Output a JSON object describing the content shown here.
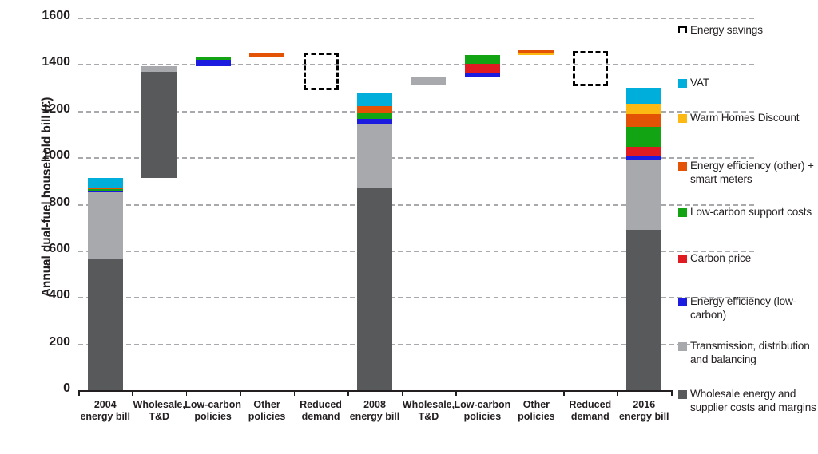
{
  "chart_data": {
    "type": "bar",
    "title": "",
    "subtitle": "",
    "xlabel": "",
    "ylabel": "Annual dual-fuel household bill (£)",
    "ylim": [
      0,
      1600
    ],
    "yticks": [
      0,
      200,
      400,
      600,
      800,
      1000,
      1200,
      1400,
      1600
    ],
    "grid": true,
    "legend_position": "right",
    "waterfall": true,
    "categories": [
      "2004 energy bill",
      "Wholesale, T&D",
      "Low-carbon policies",
      "Other policies",
      "Reduced demand",
      "2008 energy bill",
      "Wholesale, T&D",
      "Low-carbon policies",
      "Other policies",
      "Reduced demand",
      "2016 energy bill"
    ],
    "series": [
      {
        "name": "Wholesale energy and supplier costs and margins",
        "color": "#58595b",
        "values": [
          565,
          455,
          0,
          0,
          0,
          870,
          0,
          0,
          0,
          0,
          690
        ]
      },
      {
        "name": "Transmission, distribution and balancing",
        "color": "#a7a9ac",
        "values": [
          285,
          20,
          0,
          0,
          0,
          275,
          35,
          0,
          0,
          0,
          300
        ]
      },
      {
        "name": "Energy efficiency (low-carbon)",
        "color": "#1c1ce0",
        "values": [
          5,
          0,
          28,
          0,
          0,
          20,
          0,
          15,
          0,
          0,
          15
        ]
      },
      {
        "name": "Carbon price",
        "color": "#e01b22",
        "values": [
          0,
          0,
          0,
          0,
          0,
          0,
          0,
          40,
          0,
          0,
          40
        ]
      },
      {
        "name": "Low-carbon support costs",
        "color": "#13a413",
        "values": [
          8,
          0,
          10,
          0,
          0,
          25,
          0,
          38,
          0,
          0,
          85
        ]
      },
      {
        "name": "Energy efficiency (other) + smart meters",
        "color": "#e35205",
        "values": [
          7,
          0,
          0,
          22,
          0,
          28,
          0,
          0,
          10,
          0,
          55
        ]
      },
      {
        "name": "Warm Homes Discount",
        "color": "#fdb913",
        "values": [
          0,
          0,
          0,
          0,
          0,
          0,
          0,
          0,
          12,
          0,
          45
        ]
      },
      {
        "name": "VAT",
        "color": "#00aedb",
        "values": [
          43,
          0,
          0,
          0,
          0,
          57,
          0,
          0,
          0,
          0,
          70
        ]
      },
      {
        "name": "Energy savings",
        "color": "#000000",
        "style": "dashed-outline",
        "values": [
          0,
          0,
          0,
          0,
          -150,
          0,
          0,
          0,
          0,
          -150,
          0
        ]
      }
    ],
    "bar_stacks": [
      {
        "label": "2004 energy bill",
        "type": "total",
        "base": 0,
        "segments": [
          {
            "name": "Wholesale energy and supplier costs and margins",
            "color": "#58595b",
            "from": 0,
            "to": 565
          },
          {
            "name": "Transmission, distribution and balancing",
            "color": "#a7a9ac",
            "from": 565,
            "to": 850
          },
          {
            "name": "Energy efficiency (low-carbon)",
            "color": "#1c1ce0",
            "from": 850,
            "to": 855
          },
          {
            "name": "Low-carbon support costs",
            "color": "#13a413",
            "from": 855,
            "to": 863
          },
          {
            "name": "Energy efficiency (other) + smart meters",
            "color": "#e35205",
            "from": 863,
            "to": 870
          },
          {
            "name": "VAT",
            "color": "#00aedb",
            "from": 870,
            "to": 913
          }
        ]
      },
      {
        "label": "Wholesale, T&D",
        "type": "delta",
        "base": 913,
        "segments": [
          {
            "name": "Wholesale energy and supplier costs and margins",
            "color": "#58595b",
            "from": 913,
            "to": 1368
          },
          {
            "name": "Transmission, distribution and balancing",
            "color": "#a7a9ac",
            "from": 1368,
            "to": 1390
          }
        ]
      },
      {
        "label": "Low-carbon policies",
        "type": "delta",
        "base": 1390,
        "segments": [
          {
            "name": "Energy efficiency (low-carbon)",
            "color": "#1c1ce0",
            "from": 1390,
            "to": 1418
          },
          {
            "name": "Low-carbon support costs",
            "color": "#13a413",
            "from": 1418,
            "to": 1428
          }
        ]
      },
      {
        "label": "Other policies",
        "type": "delta",
        "base": 1428,
        "segments": [
          {
            "name": "Energy efficiency (other) + smart meters",
            "color": "#e35205",
            "from": 1428,
            "to": 1448
          }
        ]
      },
      {
        "label": "Reduced demand",
        "type": "savings",
        "base": 1448,
        "segments": [
          {
            "name": "Energy savings",
            "color": "#000000",
            "from": 1288,
            "to": 1448,
            "dashed": true
          }
        ]
      },
      {
        "label": "2008 energy bill",
        "type": "total",
        "base": 0,
        "segments": [
          {
            "name": "Wholesale energy and supplier costs and margins",
            "color": "#58595b",
            "from": 0,
            "to": 870
          },
          {
            "name": "Transmission, distribution and balancing",
            "color": "#a7a9ac",
            "from": 870,
            "to": 1145
          },
          {
            "name": "Energy efficiency (low-carbon)",
            "color": "#1c1ce0",
            "from": 1145,
            "to": 1165
          },
          {
            "name": "Low-carbon support costs",
            "color": "#13a413",
            "from": 1165,
            "to": 1190
          },
          {
            "name": "Energy efficiency (other) + smart meters",
            "color": "#e35205",
            "from": 1190,
            "to": 1218
          },
          {
            "name": "VAT",
            "color": "#00aedb",
            "from": 1218,
            "to": 1275
          }
        ]
      },
      {
        "label": "Wholesale, T&D",
        "type": "delta",
        "base": 1275,
        "segments": [
          {
            "name": "Transmission, distribution and balancing",
            "color": "#a7a9ac",
            "from": 1310,
            "to": 1345
          }
        ]
      },
      {
        "label": "Low-carbon policies",
        "type": "delta",
        "base": 1345,
        "segments": [
          {
            "name": "Energy efficiency (low-carbon)",
            "color": "#1c1ce0",
            "from": 1345,
            "to": 1360
          },
          {
            "name": "Carbon price",
            "color": "#e01b22",
            "from": 1360,
            "to": 1400
          },
          {
            "name": "Low-carbon support costs",
            "color": "#13a413",
            "from": 1400,
            "to": 1438
          }
        ]
      },
      {
        "label": "Other policies",
        "type": "delta",
        "base": 1438,
        "segments": [
          {
            "name": "Warm Homes Discount",
            "color": "#fdb913",
            "from": 1438,
            "to": 1450
          },
          {
            "name": "Energy efficiency (other) + smart meters",
            "color": "#e35205",
            "from": 1450,
            "to": 1460
          }
        ]
      },
      {
        "label": "Reduced demand",
        "type": "savings",
        "base": 1460,
        "segments": [
          {
            "name": "Energy savings",
            "color": "#000000",
            "from": 1305,
            "to": 1455,
            "dashed": true
          }
        ]
      },
      {
        "label": "2016 energy bill",
        "type": "total",
        "base": 0,
        "segments": [
          {
            "name": "Wholesale energy and supplier costs and margins",
            "color": "#58595b",
            "from": 0,
            "to": 690
          },
          {
            "name": "Transmission, distribution and balancing",
            "color": "#a7a9ac",
            "from": 690,
            "to": 990
          },
          {
            "name": "Energy efficiency (low-carbon)",
            "color": "#1c1ce0",
            "from": 990,
            "to": 1005
          },
          {
            "name": "Carbon price",
            "color": "#e01b22",
            "from": 1005,
            "to": 1045
          },
          {
            "name": "Low-carbon support costs",
            "color": "#13a413",
            "from": 1045,
            "to": 1130
          },
          {
            "name": "Energy efficiency (other) + smart meters",
            "color": "#e35205",
            "from": 1130,
            "to": 1185
          },
          {
            "name": "Warm Homes Discount",
            "color": "#fdb913",
            "from": 1185,
            "to": 1230
          },
          {
            "name": "VAT",
            "color": "#00aedb",
            "from": 1230,
            "to": 1300
          }
        ]
      }
    ],
    "legend": [
      {
        "label": "Energy savings",
        "color": "#000000",
        "style": "dashed-outline"
      },
      {
        "label": "VAT",
        "color": "#00aedb",
        "style": "solid"
      },
      {
        "label": "Warm Homes Discount",
        "color": "#fdb913",
        "style": "solid"
      },
      {
        "label": "Energy efficiency (other) + smart meters",
        "color": "#e35205",
        "style": "solid"
      },
      {
        "label": "Low-carbon support costs",
        "color": "#13a413",
        "style": "solid"
      },
      {
        "label": "Carbon price",
        "color": "#e01b22",
        "style": "solid"
      },
      {
        "label": "Energy efficiency (low-carbon)",
        "color": "#1c1ce0",
        "style": "solid"
      },
      {
        "label": "Transmission, distribution and balancing",
        "color": "#a7a9ac",
        "style": "solid"
      },
      {
        "label": "Wholesale energy and supplier costs and margins",
        "color": "#58595b",
        "style": "solid"
      }
    ]
  },
  "axis": {
    "y_title": "Annual dual-fuel household bill (£)",
    "y_ticks": [
      "1600",
      "1400",
      "1200",
      "1000",
      "800",
      "600",
      "400",
      "200",
      "0"
    ]
  },
  "x_labels": [
    "2004\nenergy bill",
    "Wholesale,\nT&D",
    "Low-carbon\npolicies",
    "Other\npolicies",
    "Reduced\ndemand",
    "2008\nenergy bill",
    "Wholesale,\nT&D",
    "Low-carbon\npolicies",
    "Other\npolicies",
    "Reduced\ndemand",
    "2016\nenergy bill"
  ],
  "legend_labels": {
    "energy_savings": "Energy savings",
    "vat": "VAT",
    "warm_homes": "Warm Homes Discount",
    "ee_other": "Energy efficiency (other) + smart meters",
    "lowcarbon_support": "Low-carbon support costs",
    "carbon_price": "Carbon price",
    "ee_lowcarbon": "Energy efficiency (low-carbon)",
    "transmission": "Transmission, distribution and balancing",
    "wholesale": "Wholesale energy and supplier costs and margins"
  }
}
